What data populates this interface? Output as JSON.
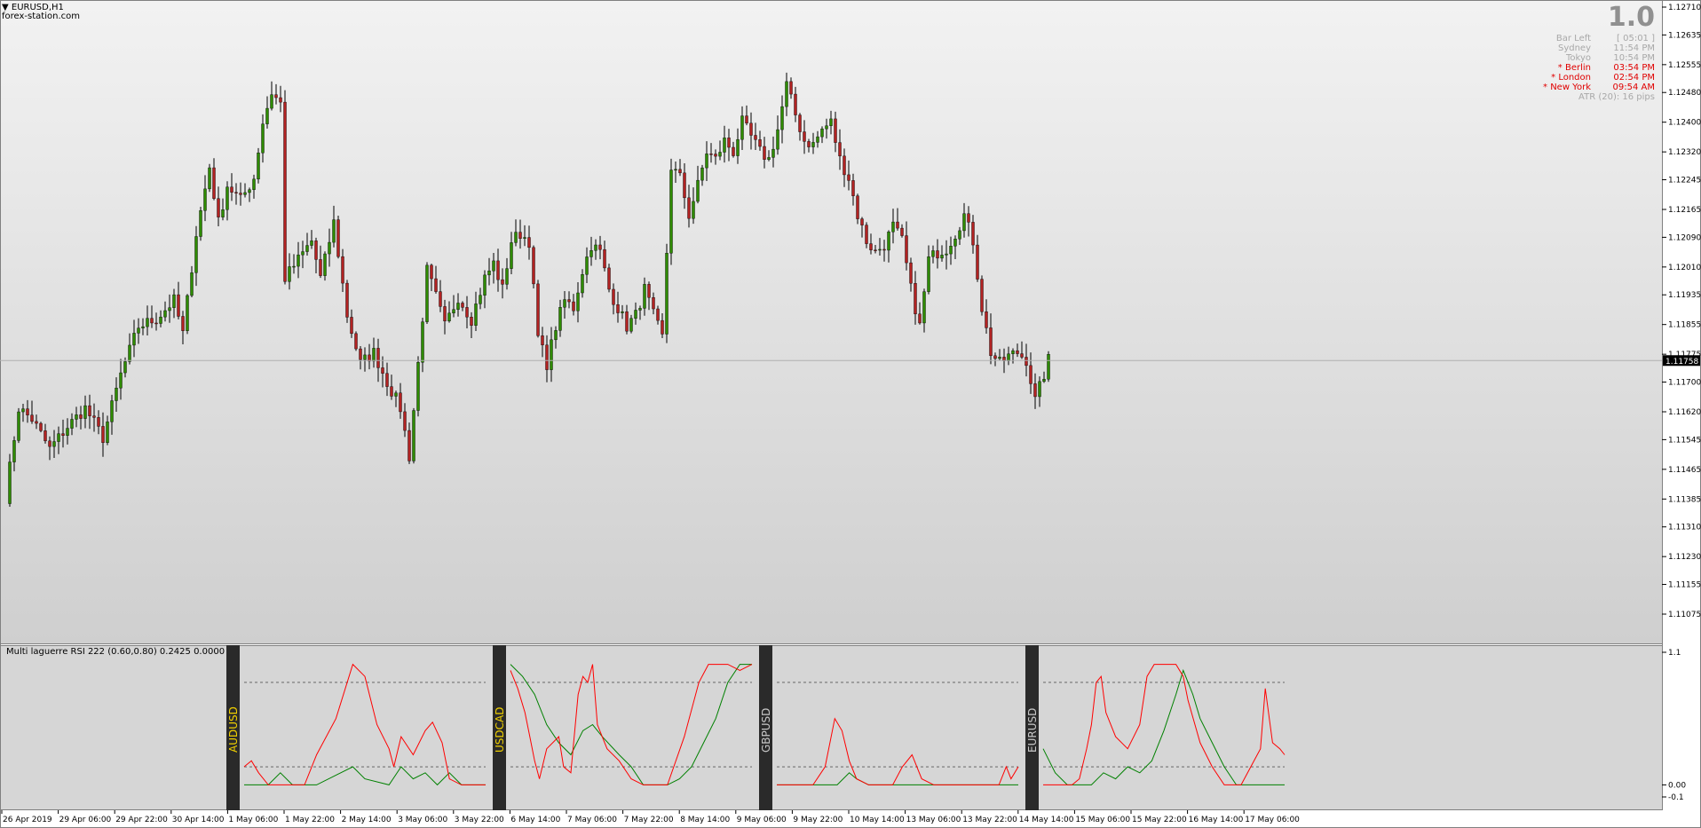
{
  "window": {
    "symbol_title": "EURUSD,H1",
    "site": "forex-station.com"
  },
  "hud": {
    "big_value": "1.0",
    "rows": [
      {
        "label": "Bar Left",
        "value": "[ 05:01 ]",
        "highlight": false
      },
      {
        "label": "Sydney",
        "value": "11:54 PM",
        "highlight": false
      },
      {
        "label": "Tokyo",
        "value": "10:54 PM",
        "highlight": false
      },
      {
        "label": "* Berlin",
        "value": "03:54 PM",
        "highlight": true
      },
      {
        "label": "* London",
        "value": "02:54 PM",
        "highlight": true
      },
      {
        "label": "* New York",
        "value": "09:54 AM",
        "highlight": true
      }
    ],
    "atr": "ATR (20): 16 pips"
  },
  "subwindow": {
    "title": "Multi laguerre RSI 222 (0.60,0.80) 0.2425 0.0000",
    "scale_labels": [
      "1.1",
      "0.00",
      "-0.1"
    ],
    "pairs": [
      "AUDUSD",
      "USDCAD",
      "GBPUSD",
      "EURUSD"
    ],
    "pair_colors": [
      "#f0d000",
      "#f0d000",
      "#c8c8c8",
      "#c8c8c8"
    ]
  },
  "colors": {
    "bull": "#2e8b00",
    "bear": "#b22222",
    "red_line": "#ff0000",
    "green_line": "#008000",
    "tab_bg": "#2a2a2a",
    "axis_bg": "#ffffff",
    "current_price_bg": "#000000"
  },
  "chart_data": {
    "type": "candlestick",
    "symbol": "EURUSD",
    "timeframe": "H1",
    "current_price": "1.11758",
    "y_ticks": [
      "1.12710",
      "1.12635",
      "1.12555",
      "1.12480",
      "1.12400",
      "1.12320",
      "1.12245",
      "1.12165",
      "1.12090",
      "1.12010",
      "1.11935",
      "1.11855",
      "1.11775",
      "1.11700",
      "1.11620",
      "1.11545",
      "1.11465",
      "1.11385",
      "1.11310",
      "1.11230",
      "1.11155",
      "1.11075"
    ],
    "ylim": [
      1.11075,
      1.1271
    ],
    "x_ticks": [
      "26 Apr 2019",
      "29 Apr 06:00",
      "29 Apr 22:00",
      "30 Apr 14:00",
      "1 May 06:00",
      "1 May 22:00",
      "2 May 14:00",
      "3 May 06:00",
      "3 May 22:00",
      "6 May 14:00",
      "7 May 06:00",
      "7 May 22:00",
      "8 May 14:00",
      "9 May 06:00",
      "9 May 22:00",
      "10 May 14:00",
      "13 May 06:00",
      "13 May 22:00",
      "14 May 14:00",
      "15 May 06:00",
      "15 May 22:00",
      "16 May 14:00",
      "17 May 06:00"
    ],
    "close_path": [
      [
        0,
        1.1139
      ],
      [
        3,
        1.1163
      ],
      [
        6,
        1.116
      ],
      [
        10,
        1.1152
      ],
      [
        14,
        1.1158
      ],
      [
        18,
        1.1163
      ],
      [
        22,
        1.1155
      ],
      [
        26,
        1.1172
      ],
      [
        30,
        1.1185
      ],
      [
        34,
        1.1187
      ],
      [
        38,
        1.1192
      ],
      [
        40,
        1.1183
      ],
      [
        43,
        1.121
      ],
      [
        46,
        1.1228
      ],
      [
        48,
        1.1213
      ],
      [
        50,
        1.1223
      ],
      [
        53,
        1.1219
      ],
      [
        56,
        1.1225
      ],
      [
        58,
        1.124
      ],
      [
        60,
        1.1248
      ],
      [
        62,
        1.1245
      ],
      [
        63,
        1.1198
      ],
      [
        66,
        1.1203
      ],
      [
        69,
        1.1208
      ],
      [
        71,
        1.1198
      ],
      [
        74,
        1.1213
      ],
      [
        77,
        1.1188
      ],
      [
        80,
        1.1175
      ],
      [
        83,
        1.1178
      ],
      [
        86,
        1.117
      ],
      [
        89,
        1.1163
      ],
      [
        91,
        1.115
      ],
      [
        93,
        1.1175
      ],
      [
        95,
        1.12
      ],
      [
        97,
        1.1193
      ],
      [
        99,
        1.1185
      ],
      [
        102,
        1.1193
      ],
      [
        105,
        1.1187
      ],
      [
        108,
        1.1198
      ],
      [
        110,
        1.1202
      ],
      [
        112,
        1.1195
      ],
      [
        114,
        1.1208
      ],
      [
        116,
        1.121
      ],
      [
        118,
        1.1208
      ],
      [
        120,
        1.1182
      ],
      [
        122,
        1.1175
      ],
      [
        124,
        1.1185
      ],
      [
        126,
        1.1192
      ],
      [
        128,
        1.119
      ],
      [
        130,
        1.12
      ],
      [
        132,
        1.1207
      ],
      [
        134,
        1.1205
      ],
      [
        136,
        1.1195
      ],
      [
        138,
        1.119
      ],
      [
        140,
        1.1185
      ],
      [
        142,
        1.1188
      ],
      [
        144,
        1.1195
      ],
      [
        146,
        1.1188
      ],
      [
        148,
        1.1182
      ],
      [
        150,
        1.1228
      ],
      [
        152,
        1.1225
      ],
      [
        154,
        1.1215
      ],
      [
        156,
        1.1223
      ],
      [
        158,
        1.1232
      ],
      [
        160,
        1.123
      ],
      [
        162,
        1.1235
      ],
      [
        164,
        1.1232
      ],
      [
        166,
        1.124
      ],
      [
        168,
        1.1236
      ],
      [
        170,
        1.1232
      ],
      [
        172,
        1.123
      ],
      [
        174,
        1.1238
      ],
      [
        176,
        1.125
      ],
      [
        178,
        1.1242
      ],
      [
        180,
        1.1235
      ],
      [
        182,
        1.1234
      ],
      [
        184,
        1.1238
      ],
      [
        186,
        1.124
      ],
      [
        188,
        1.123
      ],
      [
        190,
        1.1225
      ],
      [
        192,
        1.1215
      ],
      [
        194,
        1.1208
      ],
      [
        196,
        1.1205
      ],
      [
        198,
        1.1207
      ],
      [
        200,
        1.1212
      ],
      [
        202,
        1.1208
      ],
      [
        204,
        1.1195
      ],
      [
        206,
        1.1185
      ],
      [
        208,
        1.1203
      ],
      [
        210,
        1.1205
      ],
      [
        212,
        1.1206
      ],
      [
        214,
        1.121
      ],
      [
        216,
        1.1215
      ],
      [
        218,
        1.1208
      ],
      [
        220,
        1.119
      ],
      [
        222,
        1.1178
      ],
      [
        224,
        1.1175
      ],
      [
        226,
        1.1177
      ],
      [
        228,
        1.1178
      ],
      [
        230,
        1.1176
      ],
      [
        232,
        1.1165
      ],
      [
        234,
        1.1172
      ],
      [
        235,
        1.1176
      ]
    ],
    "total_bars": 235
  },
  "indicator_data": {
    "type": "line",
    "ylim": [
      -0.1,
      1.1
    ],
    "levels": [
      0.85,
      0.15
    ],
    "windows": [
      {
        "pair": "AUDUSD",
        "red": [
          [
            0,
            0.15
          ],
          [
            0.03,
            0.2
          ],
          [
            0.06,
            0.1
          ],
          [
            0.1,
            0
          ],
          [
            0.25,
            0
          ],
          [
            0.3,
            0.25
          ],
          [
            0.38,
            0.55
          ],
          [
            0.45,
            1.0
          ],
          [
            0.5,
            0.9
          ],
          [
            0.55,
            0.5
          ],
          [
            0.6,
            0.3
          ],
          [
            0.62,
            0.15
          ],
          [
            0.65,
            0.4
          ],
          [
            0.7,
            0.25
          ],
          [
            0.75,
            0.45
          ],
          [
            0.78,
            0.52
          ],
          [
            0.82,
            0.35
          ],
          [
            0.85,
            0.05
          ],
          [
            0.9,
            0
          ],
          [
            1,
            0
          ]
        ],
        "green": [
          [
            0,
            0
          ],
          [
            0.1,
            0
          ],
          [
            0.15,
            0.1
          ],
          [
            0.2,
            0
          ],
          [
            0.3,
            0
          ],
          [
            0.4,
            0.1
          ],
          [
            0.45,
            0.15
          ],
          [
            0.5,
            0.05
          ],
          [
            0.6,
            0
          ],
          [
            0.65,
            0.15
          ],
          [
            0.7,
            0.05
          ],
          [
            0.75,
            0.1
          ],
          [
            0.8,
            0
          ],
          [
            0.85,
            0.1
          ],
          [
            0.9,
            0
          ],
          [
            1,
            0
          ]
        ]
      },
      {
        "pair": "USDCAD",
        "red": [
          [
            0,
            0.95
          ],
          [
            0.03,
            0.8
          ],
          [
            0.06,
            0.6
          ],
          [
            0.08,
            0.4
          ],
          [
            0.1,
            0.2
          ],
          [
            0.12,
            0.05
          ],
          [
            0.15,
            0.3
          ],
          [
            0.2,
            0.4
          ],
          [
            0.22,
            0.15
          ],
          [
            0.25,
            0.1
          ],
          [
            0.28,
            0.75
          ],
          [
            0.3,
            0.9
          ],
          [
            0.32,
            0.85
          ],
          [
            0.34,
            1.0
          ],
          [
            0.36,
            0.5
          ],
          [
            0.4,
            0.3
          ],
          [
            0.45,
            0.2
          ],
          [
            0.5,
            0.05
          ],
          [
            0.55,
            0
          ],
          [
            0.65,
            0
          ],
          [
            0.72,
            0.4
          ],
          [
            0.78,
            0.85
          ],
          [
            0.82,
            1.0
          ],
          [
            0.9,
            1.0
          ],
          [
            0.95,
            0.95
          ],
          [
            1,
            1.0
          ]
        ],
        "green": [
          [
            0,
            1.0
          ],
          [
            0.05,
            0.9
          ],
          [
            0.1,
            0.75
          ],
          [
            0.15,
            0.5
          ],
          [
            0.2,
            0.35
          ],
          [
            0.25,
            0.25
          ],
          [
            0.3,
            0.45
          ],
          [
            0.34,
            0.5
          ],
          [
            0.38,
            0.4
          ],
          [
            0.45,
            0.25
          ],
          [
            0.5,
            0.15
          ],
          [
            0.55,
            0
          ],
          [
            0.65,
            0
          ],
          [
            0.7,
            0.05
          ],
          [
            0.75,
            0.15
          ],
          [
            0.8,
            0.35
          ],
          [
            0.85,
            0.55
          ],
          [
            0.9,
            0.85
          ],
          [
            0.95,
            1.0
          ],
          [
            1,
            1.0
          ]
        ]
      },
      {
        "pair": "GBPUSD",
        "red": [
          [
            0,
            0
          ],
          [
            0.15,
            0
          ],
          [
            0.2,
            0.15
          ],
          [
            0.24,
            0.55
          ],
          [
            0.27,
            0.45
          ],
          [
            0.3,
            0.2
          ],
          [
            0.33,
            0.05
          ],
          [
            0.38,
            0
          ],
          [
            0.48,
            0
          ],
          [
            0.52,
            0.15
          ],
          [
            0.56,
            0.25
          ],
          [
            0.6,
            0.05
          ],
          [
            0.65,
            0
          ],
          [
            0.92,
            0
          ],
          [
            0.95,
            0.15
          ],
          [
            0.97,
            0.05
          ],
          [
            1,
            0.15
          ]
        ],
        "green": [
          [
            0,
            0
          ],
          [
            0.25,
            0
          ],
          [
            0.3,
            0.1
          ],
          [
            0.33,
            0.05
          ],
          [
            0.38,
            0
          ],
          [
            1,
            0
          ]
        ]
      },
      {
        "pair": "EURUSD",
        "red": [
          [
            0,
            0
          ],
          [
            0.12,
            0
          ],
          [
            0.15,
            0.05
          ],
          [
            0.18,
            0.3
          ],
          [
            0.2,
            0.5
          ],
          [
            0.22,
            0.85
          ],
          [
            0.24,
            0.9
          ],
          [
            0.26,
            0.6
          ],
          [
            0.3,
            0.4
          ],
          [
            0.35,
            0.3
          ],
          [
            0.4,
            0.5
          ],
          [
            0.43,
            0.9
          ],
          [
            0.46,
            1.0
          ],
          [
            0.55,
            1.0
          ],
          [
            0.58,
            0.9
          ],
          [
            0.6,
            0.7
          ],
          [
            0.65,
            0.35
          ],
          [
            0.7,
            0.15
          ],
          [
            0.75,
            0
          ],
          [
            0.82,
            0
          ],
          [
            0.86,
            0.15
          ],
          [
            0.9,
            0.3
          ],
          [
            0.92,
            0.8
          ],
          [
            0.95,
            0.35
          ],
          [
            0.98,
            0.3
          ],
          [
            1,
            0.25
          ]
        ],
        "green": [
          [
            0,
            0.3
          ],
          [
            0.05,
            0.1
          ],
          [
            0.1,
            0
          ],
          [
            0.2,
            0
          ],
          [
            0.25,
            0.1
          ],
          [
            0.3,
            0.05
          ],
          [
            0.35,
            0.15
          ],
          [
            0.4,
            0.1
          ],
          [
            0.45,
            0.2
          ],
          [
            0.5,
            0.45
          ],
          [
            0.55,
            0.75
          ],
          [
            0.58,
            0.95
          ],
          [
            0.62,
            0.75
          ],
          [
            0.65,
            0.55
          ],
          [
            0.7,
            0.35
          ],
          [
            0.75,
            0.15
          ],
          [
            0.8,
            0
          ],
          [
            1,
            0
          ]
        ]
      }
    ]
  }
}
